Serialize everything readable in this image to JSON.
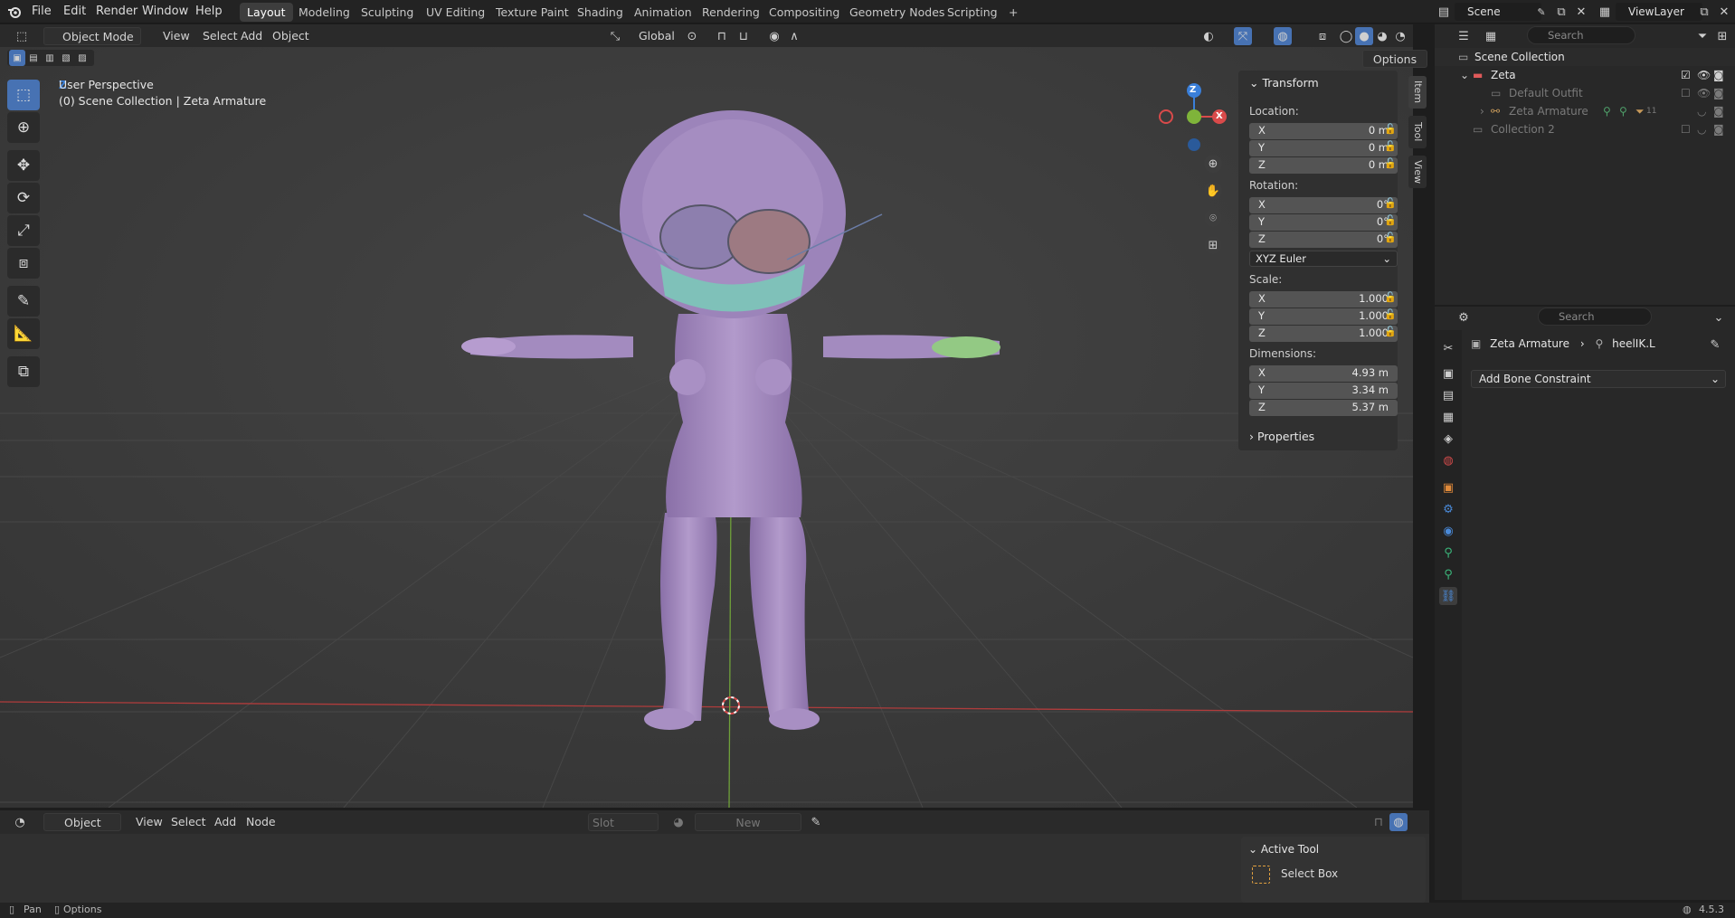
{
  "menu": {
    "items": [
      "File",
      "Edit",
      "Render",
      "Window",
      "Help"
    ],
    "workspaces": [
      "Layout",
      "Modeling",
      "Sculpting",
      "UV Editing",
      "Texture Paint",
      "Shading",
      "Animation",
      "Rendering",
      "Compositing",
      "Geometry Nodes",
      "Scripting"
    ],
    "active_workspace": "Layout",
    "add_tab": "+",
    "scene": "Scene",
    "view_layer": "ViewLayer"
  },
  "viewport_header": {
    "mode": "Object Mode",
    "menus": [
      "View",
      "Select",
      "Add",
      "Object"
    ],
    "orientation": "Global",
    "options": "Options"
  },
  "viewport": {
    "perspective": "User Perspective",
    "collection_info": "(0) Scene Collection | Zeta Armature",
    "gizmo": {
      "z": "Z",
      "x": "X"
    }
  },
  "npanel": {
    "tabs": [
      "Item",
      "Tool",
      "View"
    ],
    "transform_title": "Transform",
    "location_label": "Location:",
    "location": [
      {
        "axis": "X",
        "value": "0 m"
      },
      {
        "axis": "Y",
        "value": "0 m"
      },
      {
        "axis": "Z",
        "value": "0 m"
      }
    ],
    "rotation_label": "Rotation:",
    "rotation": [
      {
        "axis": "X",
        "value": "0°"
      },
      {
        "axis": "Y",
        "value": "0°"
      },
      {
        "axis": "Z",
        "value": "0°"
      }
    ],
    "rotation_mode": "XYZ Euler",
    "scale_label": "Scale:",
    "scale": [
      {
        "axis": "X",
        "value": "1.000"
      },
      {
        "axis": "Y",
        "value": "1.000"
      },
      {
        "axis": "Z",
        "value": "1.000"
      }
    ],
    "dimensions_label": "Dimensions:",
    "dimensions": [
      {
        "axis": "X",
        "value": "4.93 m"
      },
      {
        "axis": "Y",
        "value": "3.34 m"
      },
      {
        "axis": "Z",
        "value": "5.37 m"
      }
    ],
    "properties_title": "Properties"
  },
  "outliner": {
    "search_placeholder": "Search",
    "scene_collection": "Scene Collection",
    "rows": [
      {
        "label": "Zeta"
      },
      {
        "label": "Default Outfit"
      },
      {
        "label": "Zeta Armature",
        "badge": "11"
      },
      {
        "label": "Collection 2"
      }
    ]
  },
  "properties": {
    "search_placeholder": "Search",
    "object_name": "Zeta Armature",
    "bone_name": "heelIK.L",
    "add_constraint": "Add Bone Constraint"
  },
  "bottom_editor": {
    "mode": "Object",
    "menus": [
      "View",
      "Select",
      "Add",
      "Node"
    ],
    "slot": "Slot",
    "new_button": "New",
    "active_tool_title": "Active Tool",
    "active_tool_name": "Select Box"
  },
  "statusbar": {
    "pan": "Pan",
    "options": "Options",
    "version": "4.5.3"
  },
  "colors": {
    "accent": "#4772b3",
    "body": "#a98ec5",
    "x_axis": "#d94a4a",
    "y_axis": "#7fb43a",
    "z_axis": "#3a7fd9"
  }
}
